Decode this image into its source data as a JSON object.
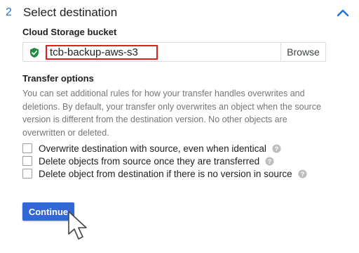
{
  "step": {
    "number": "2",
    "title": "Select destination",
    "collapse_icon": "chevron-up-icon"
  },
  "bucket": {
    "label": "Cloud Storage bucket",
    "value": "tcb-backup-aws-s3",
    "status_icon": "lock-check-icon",
    "browse_label": "Browse"
  },
  "transfer_options": {
    "label": "Transfer options",
    "description": "You can set additional rules for how your transfer handles overwrites and deletions. By default, your transfer only overwrites an object when the source version is different from the destination version. No other objects are overwritten or deleted.",
    "options": [
      {
        "label": "Overwrite destination with source, even when identical",
        "checked": false
      },
      {
        "label": "Delete objects from source once they are transferred",
        "checked": false
      },
      {
        "label": "Delete object from destination if there is no version in source",
        "checked": false
      }
    ]
  },
  "continue_label": "Continue",
  "colors": {
    "accent": "#1a73e8",
    "primary_button": "#3367d6",
    "highlight_border": "#e02020",
    "lock_green": "#1e8e3e"
  }
}
